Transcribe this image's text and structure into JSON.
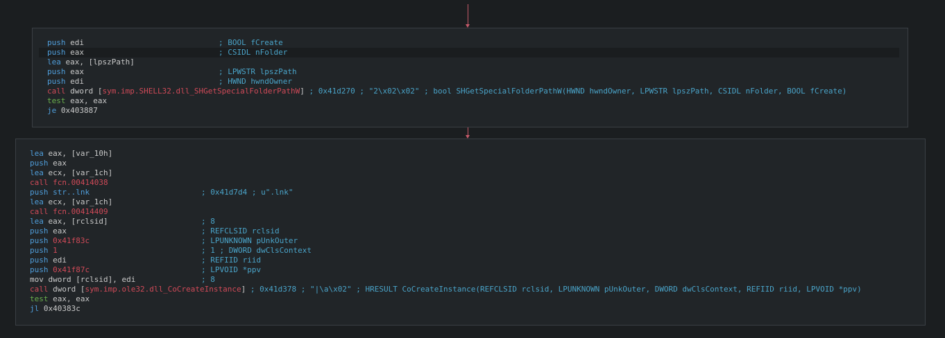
{
  "block1": {
    "lines": [
      {
        "mn": "push",
        "op": "edi",
        "cmt": "; BOOL fCreate"
      },
      {
        "mn": "push",
        "op": "eax",
        "cmt": "; CSIDL nFolder"
      },
      {
        "mn": "lea",
        "op": "eax, [lpszPath]",
        "cmt": ""
      },
      {
        "mn": "push",
        "op": "eax",
        "cmt": "; LPWSTR lpszPath"
      },
      {
        "mn": "push",
        "op": "edi",
        "cmt": "; HWND hwndOwner"
      },
      {
        "mn": "call",
        "op_prefix": "dword [",
        "op_sym": "sym.imp.SHELL32.dll_SHGetSpecialFolderPathW",
        "op_suffix": "]",
        "cmt": "; 0x41d270 ; \"2\\x02\\x02\" ; bool SHGetSpecialFolderPathW(HWND hwndOwner, LPWSTR lpszPath, CSIDL nFolder, BOOL fCreate)"
      },
      {
        "mn": "test",
        "op": "eax, eax",
        "cmt": ""
      },
      {
        "mn": "je",
        "op": "0x403887",
        "cmt": ""
      }
    ]
  },
  "block2": {
    "lines": [
      {
        "mn": "lea",
        "op": "eax, [var_10h]"
      },
      {
        "mn": "push",
        "op": "eax"
      },
      {
        "mn": "lea",
        "op": "ecx, [var_1ch]"
      },
      {
        "mn": "call",
        "op": "fcn.00414038"
      },
      {
        "mn": "push",
        "op": "str..lnk",
        "cmt": "; 0x41d7d4 ; u\".lnk\""
      },
      {
        "mn": "lea",
        "op": "ecx, [var_1ch]"
      },
      {
        "mn": "call",
        "op": "fcn.00414409"
      },
      {
        "mn": "lea",
        "op": "eax, [rclsid]",
        "cmt": "; 8"
      },
      {
        "mn": "push",
        "op": "eax",
        "cmt": "; REFCLSID rclsid"
      },
      {
        "mn": "push",
        "op": "0x41f83c",
        "cmt": "; LPUNKNOWN pUnkOuter"
      },
      {
        "mn": "push",
        "op": "1",
        "cmt": "; 1 ; DWORD dwClsContext"
      },
      {
        "mn": "push",
        "op": "edi",
        "cmt": "; REFIID riid"
      },
      {
        "mn": "push",
        "op": "0x41f87c",
        "cmt": "; LPVOID *ppv"
      },
      {
        "mn": "mov",
        "op": "dword [rclsid], edi",
        "cmt": "; 8"
      },
      {
        "mn": "call",
        "op_prefix": "dword [",
        "op_sym": "sym.imp.ole32.dll_CoCreateInstance",
        "op_suffix": "]",
        "cmt": "; 0x41d378 ; \"|\\a\\x02\" ; HRESULT CoCreateInstance(REFCLSID rclsid, LPUNKNOWN pUnkOuter, DWORD dwClsContext, REFIID riid, LPVOID *ppv)"
      },
      {
        "mn": "test",
        "op": "eax, eax"
      },
      {
        "mn": "jl",
        "op": "0x40383c"
      }
    ]
  },
  "colors": {
    "background": "#1b1e20",
    "block_bg": "#212528",
    "edge": "#c75a6a",
    "mnemonic": "#4f9edb",
    "call": "#d04a58",
    "comment": "#4aa4c9"
  }
}
